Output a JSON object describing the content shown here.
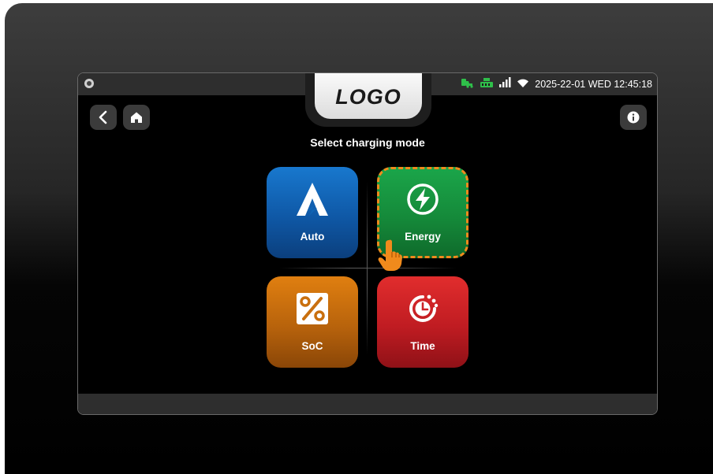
{
  "header": {
    "logo_text": "LOGO",
    "datetime": "2025-22-01 WED 12:45:18",
    "icons": [
      "camera-icon",
      "charging-station-icon",
      "network-icon",
      "signal-icon",
      "wifi-icon"
    ]
  },
  "nav": {
    "back_icon": "chevron-left-icon",
    "home_icon": "home-icon",
    "info_icon": "info-icon"
  },
  "main": {
    "title": "Select charging mode",
    "modes": [
      {
        "label": "Auto",
        "icon": "auto-a-icon",
        "color": "#1269bd"
      },
      {
        "label": "Energy",
        "icon": "bolt-icon",
        "color": "#16973f",
        "highlighted": true
      },
      {
        "label": "SoC",
        "icon": "percent-icon",
        "color": "#c96f0e"
      },
      {
        "label": "Time",
        "icon": "timer-icon",
        "color": "#cd2127"
      }
    ]
  },
  "colors": {
    "highlight_dash": "#f08a1c",
    "status_green": "#2fbf4a"
  }
}
